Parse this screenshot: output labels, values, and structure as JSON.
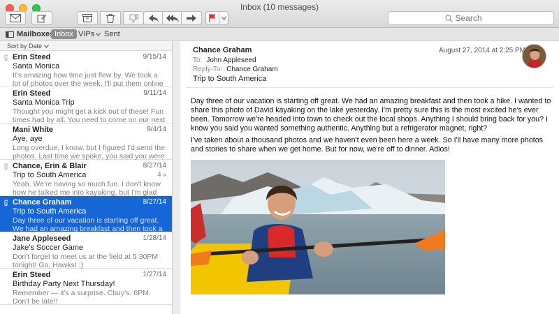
{
  "window": {
    "title": "Inbox (10 messages)"
  },
  "toolbar": {
    "search_placeholder": "Search",
    "icons": [
      "compose-envelope-icon",
      "edit-icon",
      "archive-icon",
      "trash-icon",
      "junk-icon",
      "reply-icon",
      "reply-all-icon",
      "forward-icon",
      "flag-icon"
    ],
    "flag_color": "#e5332a"
  },
  "favorites": {
    "mailboxes": "Mailboxes",
    "inbox": "Inbox",
    "vips": "VIPs",
    "sent": "Sent"
  },
  "list": {
    "sort_label": "Sort by Date",
    "messages": [
      {
        "from": "Erin Steed",
        "date": "9/15/14",
        "subject": "Santa Monica",
        "preview": "It's amazing how time just flew by. We took a lot of photos over the week, I'll put them online for every...",
        "attachment": true
      },
      {
        "from": "Erin Steed",
        "date": "9/11/14",
        "subject": "Santa Monica Trip",
        "preview": "Thought you might get a kick out of these! Fun times had by all. You need to come on our next trip later...",
        "attachment": false
      },
      {
        "from": "Mani White",
        "date": "9/4/14",
        "subject": "Aye, aye",
        "preview": "Long overdue, I know. but I figured I'd send the photos. Last time we spoke, you said you were hea...",
        "attachment": false
      },
      {
        "from": "Chance, Erin & Blair",
        "date": "8/27/14",
        "subject": "Trip to South America",
        "preview": "Yeah. We're having so much fun. I don't know how he talked me into kayaking, but I'm glad he did. I...",
        "attachment": true,
        "thread_count": "4"
      },
      {
        "from": "Chance Graham",
        "date": "8/27/14",
        "subject": "Trip to South America",
        "preview": "Day three of our vacation is starting off great. We had an amazing breakfast and then took a hike. I w...",
        "attachment": true,
        "selected": true
      },
      {
        "from": "Jane Appleseed",
        "date": "1/28/14",
        "subject": "Jake's Soccer Game",
        "preview": "Don't forget to meet us at the field at 5:30PM tonight! Go, Hawks! :)",
        "attachment": false
      },
      {
        "from": "Erin Steed",
        "date": "1/27/14",
        "subject": "Birthday Party Next Thursday!",
        "preview": "Remember — it's a surprise. Chuy's. 6PM. Don't be late!!",
        "attachment": false
      }
    ],
    "selection_color": "#1666d6"
  },
  "reader": {
    "sender": "Chance Graham",
    "date": "August 27, 2014 at 2:25 PM",
    "to_label": "To:",
    "to": "John Appleseed",
    "reply_to_label": "Reply-To:",
    "reply_to": "Chance Graham",
    "subject": "Trip to South America",
    "body_1": "Day three of our vacation is starting off great. We had an amazing breakfast and then took a hike. I wanted to share this photo of David kayaking on the lake yesterday. I'm pretty sure this is the most excited he's ever been. Tomorrow we're headed into town to check out the local shops. Anything I should bring back for you? I know you said you wanted something authentic. Anything but a refrigerator magnet, right?",
    "body_2": "I've taken about a thousand photos and we haven't even been here a week. So I'll have many more photos and stories to share when we get home. But for now, we're off to dinner. Adios!"
  }
}
